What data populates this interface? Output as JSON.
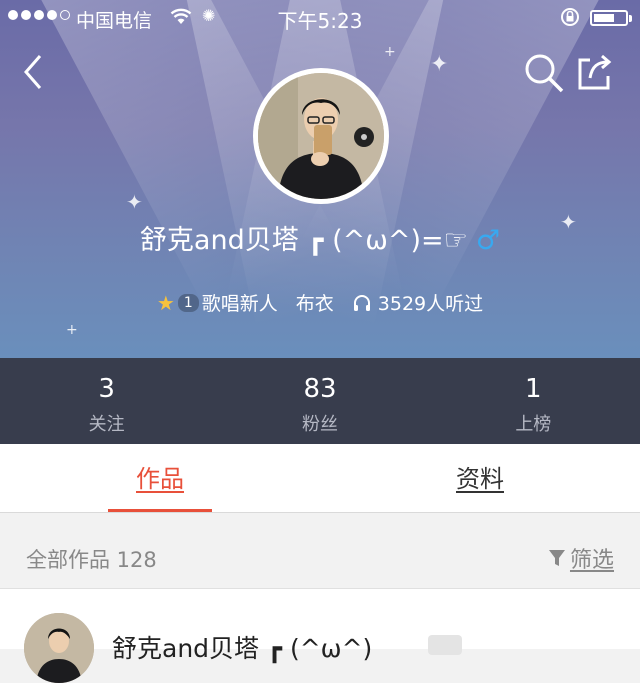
{
  "status_bar": {
    "carrier": "中国电信",
    "time": "下午5:23"
  },
  "profile": {
    "name": "舒克and贝塔 ┏ (^ω^)=☞",
    "gender_symbol": "♂",
    "level": "1",
    "title": "歌唱新人",
    "rank": "布衣",
    "listens": "3529人听过"
  },
  "stats": [
    {
      "value": "3",
      "label": "关注"
    },
    {
      "value": "83",
      "label": "粉丝"
    },
    {
      "value": "1",
      "label": "上榜"
    }
  ],
  "tabs": {
    "works": "作品",
    "info": "资料"
  },
  "works_bar": {
    "count_label": "全部作品 128",
    "filter_label": "筛选"
  },
  "list": {
    "first_item_title": "舒克and贝塔 ┏ (^ω^)"
  },
  "colors": {
    "accent": "#e8503a",
    "gender": "#38a9f0",
    "stats_bg": "#383d4d"
  },
  "icons": [
    "back-icon",
    "search-icon",
    "share-icon",
    "star-icon",
    "headphone-icon",
    "filter-icon",
    "wifi-icon",
    "lock-rotation-icon",
    "battery-icon"
  ]
}
